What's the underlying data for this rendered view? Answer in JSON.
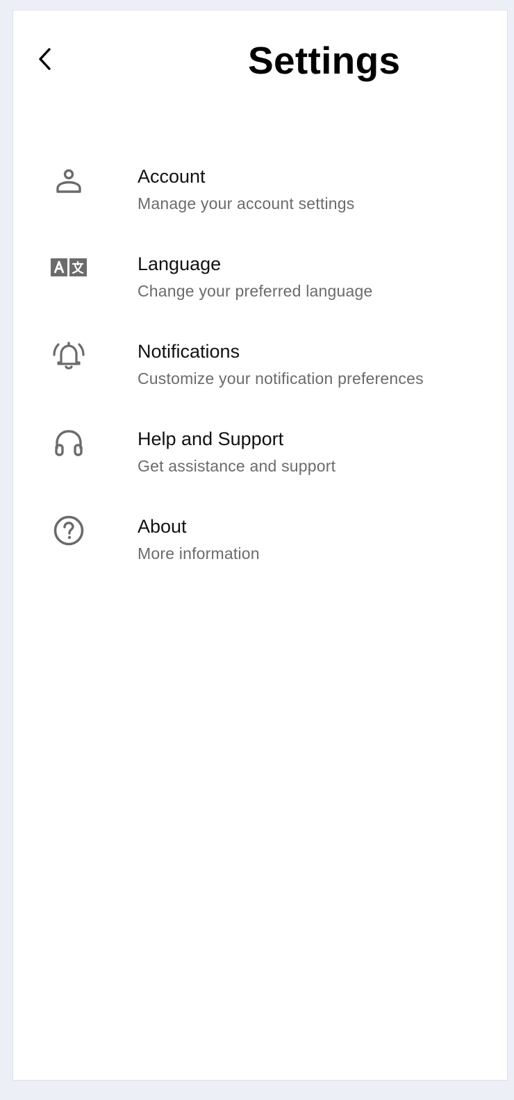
{
  "header": {
    "title": "Settings",
    "back_icon": "chevron-left-icon"
  },
  "settings": {
    "items": [
      {
        "label": "Account",
        "description": "Manage your account settings",
        "icon": "person-icon"
      },
      {
        "label": "Language",
        "description": "Change your preferred language",
        "icon": "translate-icon"
      },
      {
        "label": "Notifications",
        "description": "Customize your notification preferences",
        "icon": "bell-ringing-icon"
      },
      {
        "label": "Help and Support",
        "description": "Get assistance and support",
        "icon": "headphones-icon"
      },
      {
        "label": "About",
        "description": "More information",
        "icon": "help-circle-icon"
      }
    ]
  },
  "colors": {
    "background": "#eceff6",
    "surface": "#ffffff",
    "icon": "#6b6b6b",
    "divider": "#d9d9d9"
  }
}
